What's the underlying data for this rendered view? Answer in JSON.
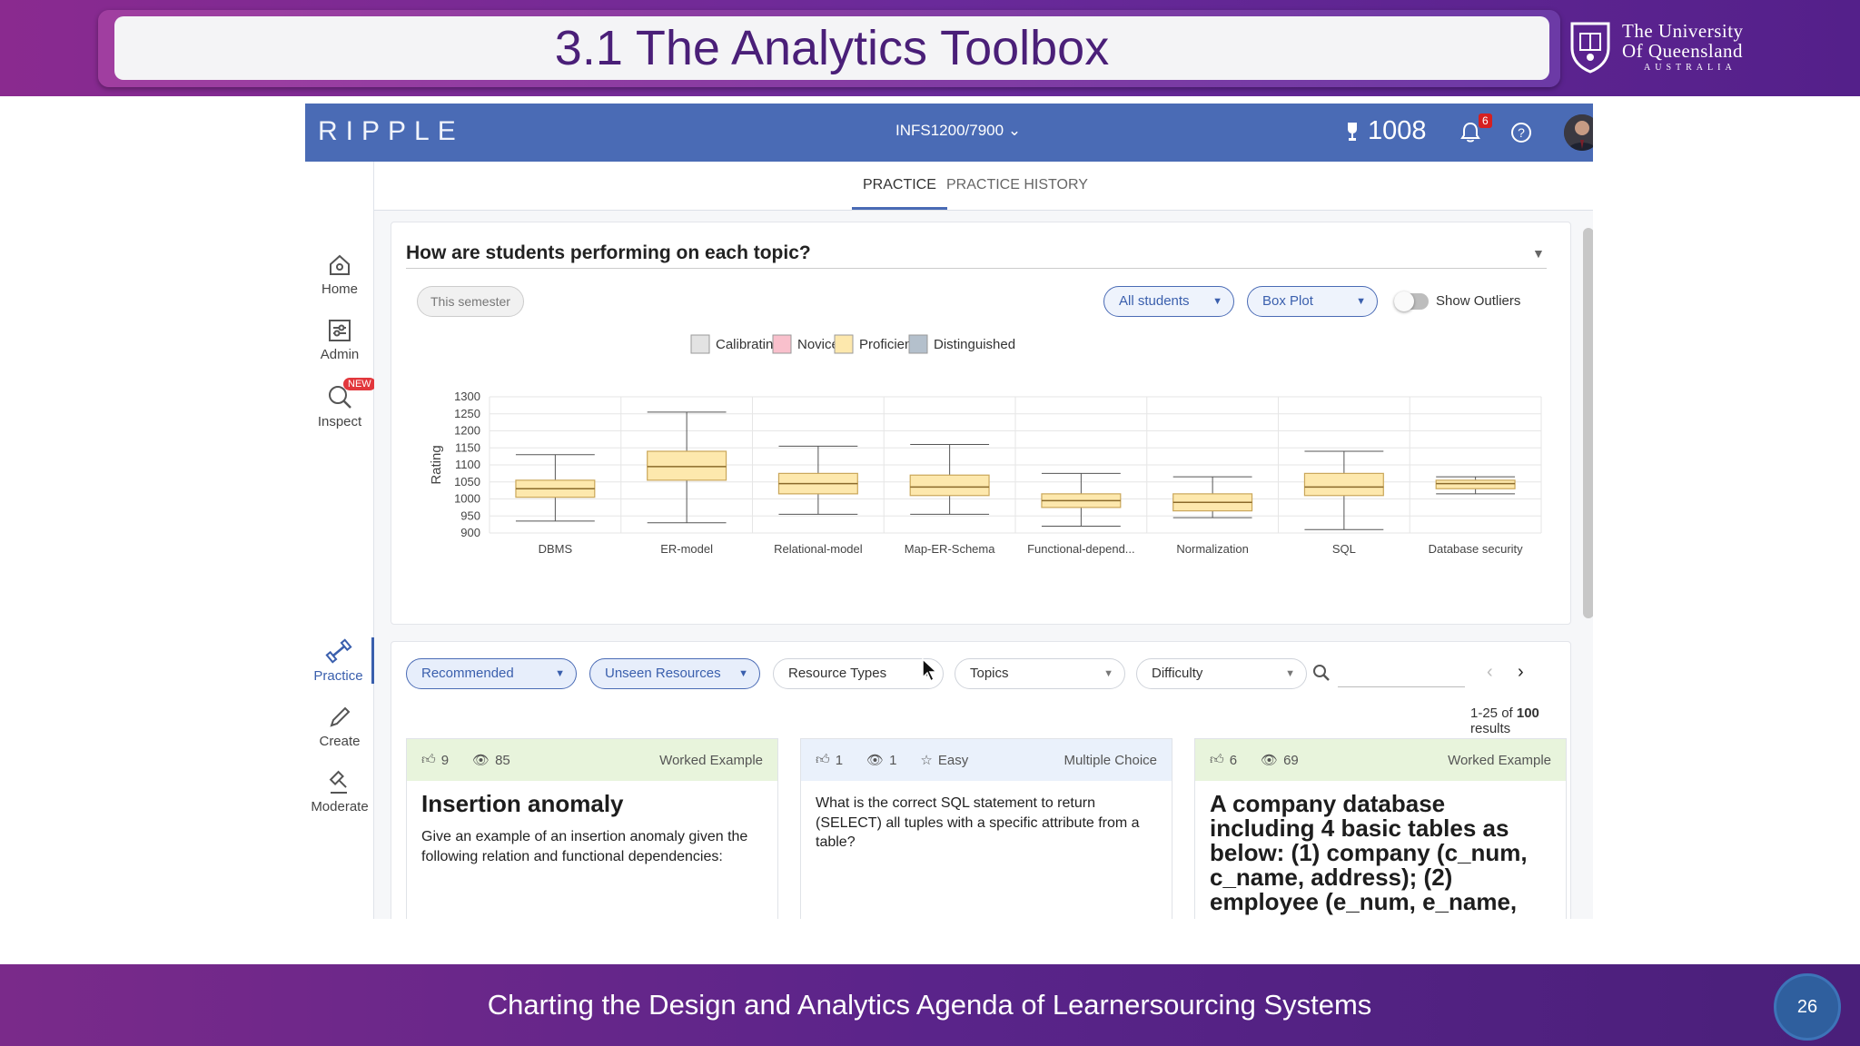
{
  "slide": {
    "title": "3.1 The Analytics Toolbox",
    "university": [
      "The University",
      "Of Queensland",
      "AUSTRALIA"
    ],
    "footer": "Charting the Design and Analytics Agenda of Learnersourcing Systems",
    "page_number": "26"
  },
  "app": {
    "logo": "RIPPLE",
    "course": "INFS1200/7900",
    "points": "1008",
    "notifications": "6",
    "nav": {
      "home": "Home",
      "admin": "Admin",
      "inspect": "Inspect",
      "new_badge": "NEW",
      "practice": "Practice",
      "create": "Create",
      "moderate": "Moderate"
    },
    "tabs": [
      "PRACTICE",
      "PRACTICE HISTORY"
    ],
    "chart_panel": {
      "heading": "How are students performing on each topic?",
      "semester": "This semester",
      "students": "All students",
      "plot_type": "Box Plot",
      "outliers_label": "Show Outliers",
      "show_outliers": false
    },
    "filters": [
      "Recommended",
      "Unseen Resources",
      "Resource Types",
      "Topics",
      "Difficulty"
    ],
    "search": {
      "placeholder": ""
    },
    "results": {
      "range": "1-25 of ",
      "total": "100",
      "suffix": " results"
    },
    "cards": [
      {
        "likes": "9",
        "views": "85",
        "difficulty": "",
        "type": "Worked Example",
        "title": "Insertion anomaly",
        "body": "Give an example of an insertion anomaly given the following relation and functional dependencies:"
      },
      {
        "likes": "1",
        "views": "1",
        "difficulty": "Easy",
        "type": "Multiple Choice",
        "title": "",
        "body": "What is the correct SQL statement to return (SELECT) all tuples with a specific attribute from a table?"
      },
      {
        "likes": "6",
        "views": "69",
        "difficulty": "",
        "type": "Worked Example",
        "title": "A company database including 4 basic tables as below: (1) company (c_num, c_name, address); (2) employee (e_num, e_name,",
        "body": ""
      }
    ],
    "colors": {
      "topbar": "#4a6bb5",
      "proficient": "#fde8ad",
      "proficient_stroke": "#caa75a"
    }
  },
  "chart_data": {
    "type": "boxplot",
    "title": "",
    "ylabel": "Rating",
    "xlabel": "",
    "ylim": [
      900,
      1300
    ],
    "yticks": [
      900,
      950,
      1000,
      1050,
      1100,
      1150,
      1200,
      1250,
      1300
    ],
    "legend": [
      "Calibrating",
      "Novice",
      "Proficient",
      "Distinguished"
    ],
    "legend_colors": [
      "#e3e3e3",
      "#f9c0cc",
      "#fde8ad",
      "#b4c0cc"
    ],
    "legend_position": "top-center",
    "grid": true,
    "categories": [
      "DBMS",
      "ER-model",
      "Relational-model",
      "Map-ER-Schema",
      "Functional-depend...",
      "Normalization",
      "SQL",
      "Database security"
    ],
    "boxes": [
      {
        "min": 935,
        "q1": 1005,
        "median": 1030,
        "q3": 1055,
        "max": 1130,
        "level": "Proficient"
      },
      {
        "min": 930,
        "q1": 1055,
        "median": 1095,
        "q3": 1140,
        "max": 1255,
        "level": "Proficient"
      },
      {
        "min": 955,
        "q1": 1015,
        "median": 1045,
        "q3": 1075,
        "max": 1155,
        "level": "Proficient"
      },
      {
        "min": 955,
        "q1": 1010,
        "median": 1035,
        "q3": 1070,
        "max": 1160,
        "level": "Proficient"
      },
      {
        "min": 920,
        "q1": 975,
        "median": 995,
        "q3": 1015,
        "max": 1075,
        "level": "Proficient"
      },
      {
        "min": 945,
        "q1": 965,
        "median": 990,
        "q3": 1015,
        "max": 1065,
        "level": "Proficient"
      },
      {
        "min": 910,
        "q1": 1010,
        "median": 1035,
        "q3": 1075,
        "max": 1140,
        "level": "Proficient"
      },
      {
        "min": 1015,
        "q1": 1030,
        "median": 1045,
        "q3": 1055,
        "max": 1065,
        "level": "Proficient"
      }
    ]
  }
}
